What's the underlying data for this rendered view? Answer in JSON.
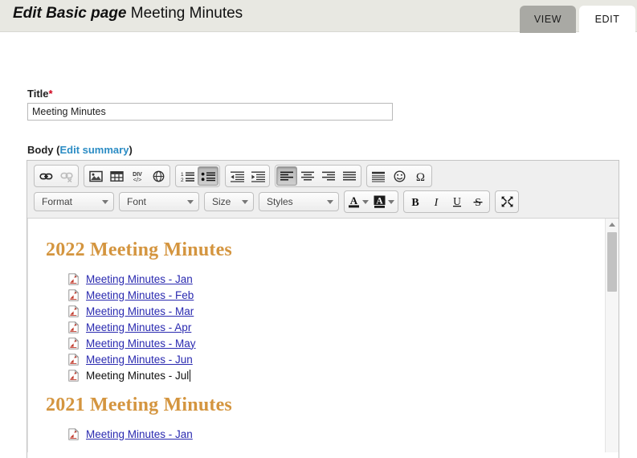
{
  "header": {
    "title_prefix": "Edit Basic page",
    "title_node": "Meeting Minutes",
    "tabs": [
      {
        "label": "VIEW",
        "active": false
      },
      {
        "label": "EDIT",
        "active": true
      }
    ]
  },
  "form": {
    "title_label": "Title",
    "required_marker": "*",
    "title_value": "Meeting Minutes",
    "title_placeholder": "",
    "body_label": "Body",
    "body_summary_open": "(",
    "body_summary_link": "Edit summary",
    "body_summary_close": ")"
  },
  "toolbar": {
    "row1": [
      {
        "name": "link-icon",
        "title": "Link",
        "state": "normal"
      },
      {
        "name": "unlink-icon",
        "title": "Unlink",
        "state": "disabled"
      },
      {
        "name": "image-icon",
        "title": "Image",
        "state": "normal"
      },
      {
        "name": "table-icon",
        "title": "Table",
        "state": "normal"
      },
      {
        "name": "div-container-icon",
        "title": "DIV Container",
        "state": "normal"
      },
      {
        "name": "media-globe-icon",
        "title": "Media",
        "state": "normal"
      },
      {
        "name": "numbered-list-icon",
        "title": "Insert/Remove Numbered List",
        "state": "normal"
      },
      {
        "name": "bulleted-list-icon",
        "title": "Insert/Remove Bulleted List",
        "state": "active"
      },
      {
        "name": "outdent-icon",
        "title": "Decrease Indent",
        "state": "normal"
      },
      {
        "name": "indent-icon",
        "title": "Increase Indent",
        "state": "normal"
      },
      {
        "name": "align-left-icon",
        "title": "Align Left",
        "state": "active"
      },
      {
        "name": "align-center-icon",
        "title": "Center",
        "state": "normal"
      },
      {
        "name": "align-right-icon",
        "title": "Align Right",
        "state": "normal"
      },
      {
        "name": "align-justify-icon",
        "title": "Justify",
        "state": "normal"
      },
      {
        "name": "blockquote-icon",
        "title": "Block Quote",
        "state": "normal"
      },
      {
        "name": "smiley-icon",
        "title": "Smiley",
        "state": "normal"
      },
      {
        "name": "special-character-icon",
        "title": "Insert Special Character",
        "state": "normal"
      }
    ],
    "combos": {
      "format": "Format",
      "font": "Font",
      "size": "Size",
      "styles": "Styles"
    },
    "row2_buttons": [
      {
        "name": "text-color-icon",
        "title": "Text Color"
      },
      {
        "name": "background-color-icon",
        "title": "Background Color"
      },
      {
        "name": "bold-button",
        "title": "Bold",
        "glyph": "B"
      },
      {
        "name": "italic-button",
        "title": "Italic",
        "glyph": "I"
      },
      {
        "name": "underline-button",
        "title": "Underline",
        "glyph": "U"
      },
      {
        "name": "strikethrough-button",
        "title": "Strike Through",
        "glyph": "S"
      },
      {
        "name": "maximize-icon",
        "title": "Maximize"
      }
    ]
  },
  "editor": {
    "sections": [
      {
        "heading": "2022 Meeting Minutes",
        "items": [
          {
            "text": "Meeting Minutes - Jan",
            "link": true
          },
          {
            "text": "Meeting Minutes - Feb",
            "link": true
          },
          {
            "text": "Meeting Minutes - Mar",
            "link": true
          },
          {
            "text": "Meeting Minutes - Apr",
            "link": true
          },
          {
            "text": "Meeting Minutes - May",
            "link": true
          },
          {
            "text": "Meeting Minutes - Jun",
            "link": true
          },
          {
            "text": "Meeting Minutes - Jul",
            "link": false,
            "cursor": true
          }
        ]
      },
      {
        "heading": "2021 Meeting Minutes",
        "items": [
          {
            "text": "Meeting Minutes - Jan",
            "link": true
          }
        ]
      }
    ]
  },
  "colors": {
    "heading": "#d4953f",
    "link": "#2a2ab0",
    "summary_link": "#2b8cc4",
    "required": "#d0021b",
    "header_bar": "#e8e8e2",
    "tab_inactive": "#a9a9a4"
  }
}
